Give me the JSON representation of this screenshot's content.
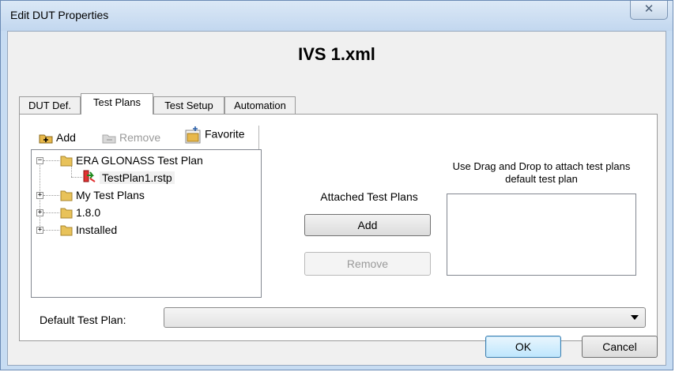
{
  "window": {
    "title": "Edit DUT Properties",
    "close_glyph": "✕",
    "close_icon": "close-icon"
  },
  "dut": {
    "filename": "IVS 1.xml"
  },
  "tabs": [
    {
      "label": "DUT Def.",
      "active": false
    },
    {
      "label": "Test Plans",
      "active": true
    },
    {
      "label": "Test Setup",
      "active": false
    },
    {
      "label": "Automation",
      "active": false
    }
  ],
  "toolbar": {
    "add_label": "Add",
    "remove_label": "Remove",
    "favorite_label": "Favorite",
    "remove_enabled": false
  },
  "tree": {
    "nodes": [
      {
        "label": "ERA GLONASS Test Plan",
        "expanded": true,
        "icon": "folder-icon"
      },
      {
        "label": "TestPlan1.rstp",
        "selected": true,
        "icon": "test-plan-file-icon"
      },
      {
        "label": "My Test Plans",
        "expanded": false,
        "icon": "folder-icon"
      },
      {
        "label": "1.8.0",
        "expanded": false,
        "icon": "folder-icon"
      },
      {
        "label": "Installed",
        "expanded": false,
        "icon": "folder-icon"
      }
    ]
  },
  "attached": {
    "label": "Attached Test Plans",
    "add_label": "Add",
    "remove_label": "Remove",
    "remove_enabled": false
  },
  "dragdrop": {
    "hint": "Use Drag and Drop to attach test plans  default test plan"
  },
  "default_plan": {
    "label": "Default Test Plan:",
    "value": ""
  },
  "footer": {
    "ok_label": "OK",
    "cancel_label": "Cancel"
  },
  "colors": {
    "title_bar": "#c7dcf2",
    "client_bg": "#f0f0f0",
    "ok_accent": "#3c7fb1",
    "folder": "#e8c25a"
  }
}
